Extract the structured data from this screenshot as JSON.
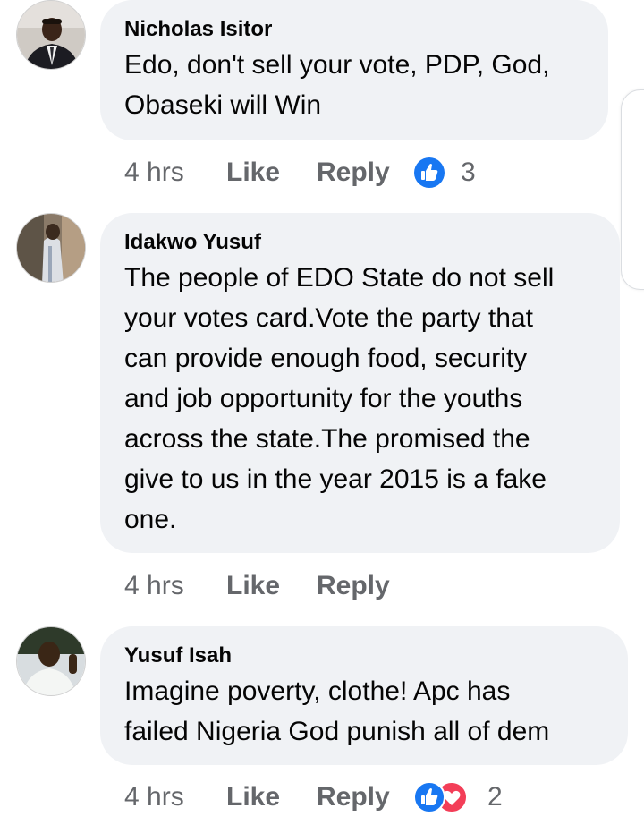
{
  "comments": [
    {
      "author": "Nicholas Isitor",
      "text": "Edo, don't sell your vote, PDP, God,\nObaseki will Win",
      "time": "4 hrs",
      "like_label": "Like",
      "reply_label": "Reply",
      "reaction_count": "3",
      "reactions": [
        "like-icon"
      ]
    },
    {
      "author": "Idakwo Yusuf",
      "text": "The people of EDO State do not sell\nyour votes card.Vote the party that\ncan provide enough food, security\nand job opportunity for the youths\nacross the state.The promised the\ngive to us in the year 2015 is a fake\none.",
      "time": "4 hrs",
      "like_label": "Like",
      "reply_label": "Reply"
    },
    {
      "author": "Yusuf Isah",
      "text": "Imagine poverty, clothe! Apc has\nfailed Nigeria God punish all of dem",
      "time": "4 hrs",
      "like_label": "Like",
      "reply_label": "Reply",
      "reaction_count": "2",
      "reactions": [
        "like-icon",
        "love-icon"
      ]
    }
  ],
  "colors": {
    "bubble": "#f0f2f5",
    "meta_text": "#65676b",
    "like_blue": "#1877f2",
    "love_red": "#f33e58"
  }
}
